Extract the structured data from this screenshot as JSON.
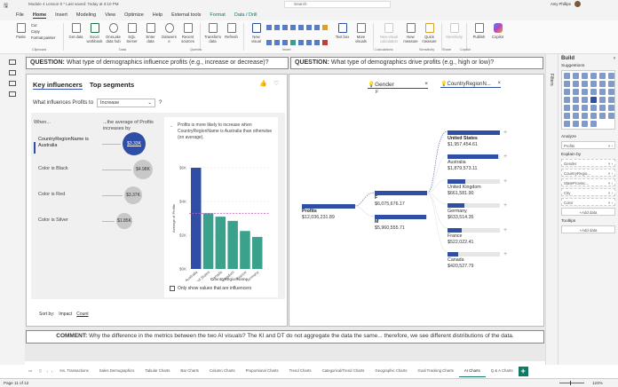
{
  "titlebar": {
    "title": "Module 4 Lesson 8 * Last saved: Today at 3:10 PM",
    "search": "Search",
    "user": "Amy Phillips",
    "share": "Share"
  },
  "menu": [
    "File",
    "Home",
    "Insert",
    "Modeling",
    "View",
    "Optimize",
    "Help",
    "External tools",
    "Format",
    "Data / Drill"
  ],
  "ribbon": {
    "buttons": [
      "Paste",
      "Get data",
      "Excel workbook",
      "OneLake data hub",
      "SQL Server",
      "Enter data",
      "Dataverse",
      "Recent sources",
      "Transform data",
      "Refresh",
      "New visual",
      "Text box",
      "More visuals",
      "New visual calculation",
      "New measure",
      "Quick measure",
      "Sensitivity",
      "Publish",
      "Copilot"
    ],
    "clipboard": [
      "Cut",
      "Copy",
      "Format painter"
    ],
    "groups": [
      "Clipboard",
      "Data",
      "Queries",
      "Insert",
      "Calculations",
      "Sensitivity",
      "Share",
      "Copilot"
    ]
  },
  "left_question": {
    "label": "QUESTION:",
    "text": "What type of demographics influence profits (e.g., increase or decrease)?"
  },
  "right_question": {
    "label": "QUESTION:",
    "text": "What type of demographics drive profits (e.g., high or low)?"
  },
  "key_influencers": {
    "tabs": [
      "Key influencers",
      "Top segments"
    ],
    "prompt": "What influences Profits to",
    "dropdown": "Increase",
    "help": "?",
    "col_when": "When...",
    "col_avg": "...the average of Profits increases by",
    "items": [
      {
        "label": "CountryRegionName is Australia",
        "value": "$3.33K"
      },
      {
        "label": "Color is Black",
        "value": "$4.98K"
      },
      {
        "label": "Color is Red",
        "value": "$3.37K"
      },
      {
        "label": "Color is Silver",
        "value": "$1.85K"
      }
    ],
    "detail_text": "Profits is more likely to increase when CountryRegionName is Australia than otherwise (on average).",
    "sort_label": "Sort by:",
    "sort_impact": "Impact",
    "sort_count": "Count",
    "checkbox": "Only show values that are influencers"
  },
  "chart_data": {
    "type": "bar",
    "title": "",
    "xlabel": "CountryRegionName",
    "ylabel": "Average of Profits",
    "categories": [
      "Australia",
      "United States",
      "Canada",
      "United Kingdom",
      "France",
      "Germany"
    ],
    "values": [
      6.0,
      3.3,
      3.1,
      2.85,
      2.25,
      1.9
    ],
    "yticks": [
      "$0K",
      "$2K",
      "$4K",
      "$6K"
    ],
    "ylim": [
      0,
      6
    ],
    "reference_line": 3.3,
    "colors": {
      "highlight": "#2f4ea6",
      "other": "#3aa28c",
      "reference": "#c060c0"
    }
  },
  "decomp": {
    "levels": [
      {
        "name": "Gender",
        "filter": "F"
      },
      {
        "name": "CountryRegionN...",
        "filter": ""
      }
    ],
    "root": {
      "label": "Profits",
      "value": "$12,036,231.89"
    },
    "gender": [
      {
        "label": "F",
        "value": "$6,075,676.17",
        "share": 1.0
      },
      {
        "label": "M",
        "value": "$5,960,555.71",
        "share": 0.98
      }
    ],
    "countries": [
      {
        "label": "United States",
        "value": "$1,957,454.61",
        "share": 1.0
      },
      {
        "label": "Australia",
        "value": "$1,879,573.11",
        "share": 0.96
      },
      {
        "label": "United Kingdom",
        "value": "$661,581.90",
        "share": 0.34
      },
      {
        "label": "Germany",
        "value": "$633,514.35",
        "share": 0.32
      },
      {
        "label": "France",
        "value": "$522,022.41",
        "share": 0.27
      },
      {
        "label": "Canada",
        "value": "$420,527.79",
        "share": 0.21
      }
    ]
  },
  "comment": {
    "label": "COMMENT:",
    "text": "Why the difference in the metrics between the two AI visuals? The KI and DT do not aggregate the data the same... therefore, we see different distributions of the data."
  },
  "pages": [
    "Ins. Transactions",
    "Sales Demographics",
    "Tabular Charts",
    "Bar Charts",
    "Column Charts",
    "Proportional Charts",
    "Trend Charts",
    "Categorical/Trend Charts",
    "Geographic Charts",
    "Goal Tracking Charts",
    "AI Charts",
    "Q & A Charts"
  ],
  "active_page": "AI Charts",
  "status": {
    "page": "Page 11 of 12",
    "zoom": "124%"
  },
  "filters_label": "Filters",
  "build": {
    "title": "Build",
    "suggestions": "Suggestions",
    "analyze": "Analyze",
    "analyze_field": "Profits",
    "explain_by": "Explain by",
    "explain_fields": [
      "Gender",
      "CountryRegio...",
      "StateProvinc...",
      "City",
      "Color"
    ],
    "add_data": "+Add data",
    "tooltips": "Tooltips"
  }
}
